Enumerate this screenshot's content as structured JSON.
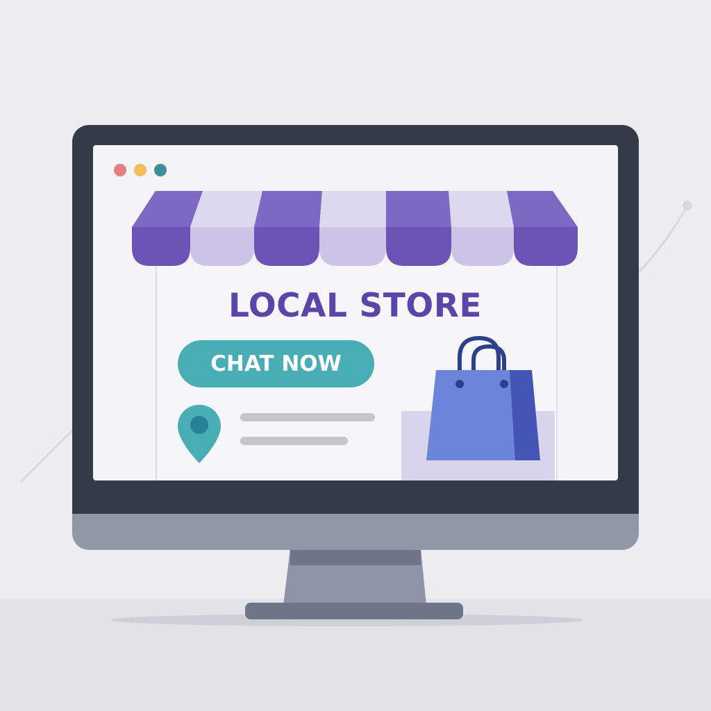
{
  "store": {
    "title": "LOCAL STORE",
    "chat_button_label": "CHAT NOW"
  },
  "window_controls": [
    {
      "name": "close-dot",
      "color": "#e57f86"
    },
    {
      "name": "minimize-dot",
      "color": "#f2bd5a"
    },
    {
      "name": "maximize-dot",
      "color": "#3c8e97"
    }
  ],
  "icons": {
    "location": "location-pin-icon",
    "bag": "shopping-bag-icon"
  },
  "colors": {
    "brand_purple": "#5b45a8",
    "awning_dark": "#6b54b6",
    "awning_light": "#cbc4e6",
    "chat_teal": "#48adb4",
    "bag_blue": "#6b86d8",
    "bezel": "#343a47",
    "chin": "#9198a8"
  }
}
